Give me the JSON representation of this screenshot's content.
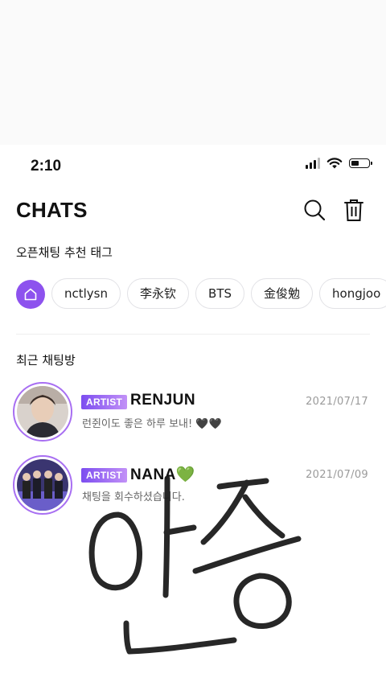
{
  "status_bar": {
    "time": "2:10",
    "battery_level": 0.45
  },
  "header": {
    "title": "CHATS"
  },
  "recommended": {
    "label": "오픈채팅 추천 태그",
    "tags": [
      "nctlysn",
      "李永钦",
      "BTS",
      "金俊勉",
      "hongjoo"
    ]
  },
  "recent": {
    "label": "최근 채팅방"
  },
  "chats": [
    {
      "badge": "ARTIST",
      "name": "RENJUN",
      "date": "2021/07/17",
      "message": "런쥔이도 좋은 하루 보내! 🖤🖤"
    },
    {
      "badge": "ARTIST",
      "name": "NANA💚",
      "date": "2021/07/09",
      "message": "채팅을 회수하셨습니다."
    }
  ],
  "overlay_text": "인증",
  "colors": {
    "accent": "#8d52ee",
    "avatar_ring": "#a86ff2",
    "date": "#9a9a9a"
  }
}
